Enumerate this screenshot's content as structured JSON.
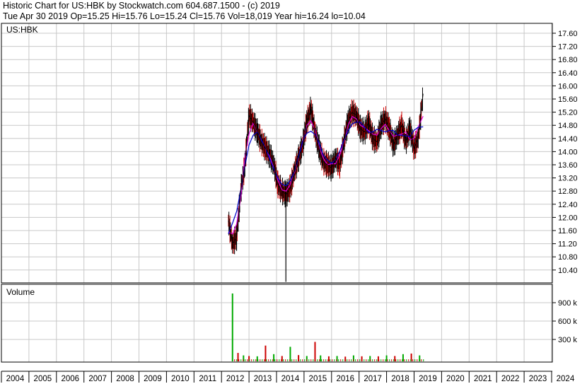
{
  "header": {
    "line1": "Historic Chart for US:HBK by Stockwatch.com 604.687.1500 - (c) 2019",
    "line2": "Tue Apr 30 2019   Op=15.25   Hi=15.76   Lo=15.24   Cl=15.76   Vol=18,019   Year hi=16.24   lo=10.04"
  },
  "colors": {
    "price": "#000000",
    "down": "#cc0000",
    "ma_short": "#dd00dd",
    "ma_long": "#0000cc",
    "vol_up": "#00aa00",
    "vol_down": "#cc0000",
    "grid": "#c8c8c8"
  },
  "chart_data": [
    {
      "type": "line",
      "title": "US:HBK",
      "yticks": [
        "17.60",
        "17.20",
        "16.80",
        "16.40",
        "16.00",
        "15.60",
        "15.20",
        "14.80",
        "14.40",
        "14.00",
        "13.60",
        "13.20",
        "12.80",
        "12.40",
        "12.00",
        "11.60",
        "11.20",
        "10.80",
        "10.40"
      ],
      "ylim": [
        10.04,
        17.9
      ],
      "xticks": [
        "2004",
        "2005",
        "2006",
        "2007",
        "2008",
        "2009",
        "2010",
        "2011",
        "2012",
        "2013",
        "2014",
        "2015",
        "2016",
        "2017",
        "2018",
        "2019",
        "2020",
        "2021",
        "2022",
        "2023",
        "2024"
      ],
      "xlim": [
        2004,
        2024
      ],
      "grid": true,
      "series": [
        {
          "x": [
            2012.25,
            2012.4,
            2012.55,
            2012.7,
            2012.85,
            2013.0,
            2013.15,
            2013.3,
            2013.45,
            2013.6,
            2013.75,
            2013.9,
            2014.05,
            2014.2,
            2014.35,
            2014.5,
            2014.65,
            2014.8,
            2014.95,
            2015.1,
            2015.25,
            2015.4,
            2015.55,
            2015.7,
            2015.85,
            2016.0,
            2016.15,
            2016.3,
            2016.45,
            2016.6,
            2016.75,
            2016.9,
            2017.05,
            2017.2,
            2017.35,
            2017.5,
            2017.65,
            2017.8,
            2017.95,
            2018.1,
            2018.25,
            2018.4,
            2018.55,
            2018.7,
            2018.85,
            2019.0,
            2019.15,
            2019.33
          ],
          "values": [
            11.9,
            11.2,
            11.4,
            12.8,
            13.6,
            15.1,
            14.9,
            14.6,
            14.3,
            14.1,
            13.9,
            13.6,
            13.0,
            12.8,
            12.7,
            12.9,
            13.4,
            13.8,
            14.2,
            14.9,
            15.3,
            14.6,
            14.1,
            13.7,
            13.6,
            13.5,
            13.8,
            13.6,
            14.3,
            14.9,
            15.2,
            15.1,
            14.7,
            14.6,
            14.9,
            14.4,
            14.3,
            14.8,
            15.0,
            14.7,
            14.2,
            14.5,
            14.8,
            14.3,
            14.7,
            14.1,
            14.4,
            15.76
          ]
        }
      ]
    },
    {
      "type": "bar",
      "title": "Volume",
      "yticks": [
        "900 k",
        "600 k",
        "300 k"
      ],
      "ylim": [
        0,
        1100
      ],
      "x": [
        2012.4,
        2012.6,
        2012.8,
        2013.0,
        2013.3,
        2013.6,
        2013.9,
        2014.2,
        2014.5,
        2014.8,
        2015.1,
        2015.4,
        2015.6,
        2015.9,
        2016.2,
        2016.5,
        2016.8,
        2017.1,
        2017.4,
        2017.7,
        2018.0,
        2018.3,
        2018.6,
        2018.9,
        2019.2
      ],
      "values": [
        1050,
        80,
        40,
        30,
        25,
        200,
        60,
        30,
        180,
        45,
        30,
        260,
        40,
        25,
        30,
        20,
        40,
        25,
        30,
        25,
        40,
        30,
        60,
        70,
        40
      ]
    }
  ]
}
